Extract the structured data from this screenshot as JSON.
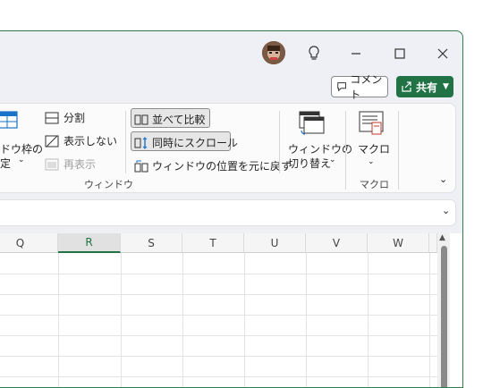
{
  "titlebar": {
    "minimize_icon": "minimize-icon",
    "maximize_icon": "maximize-icon",
    "close_icon": "close-icon",
    "lightbulb_icon": "lightbulb-icon"
  },
  "header": {
    "comment_label": "コメント",
    "share_label": "共有"
  },
  "ribbon": {
    "freeze_label_1": "ドウ枠の",
    "freeze_label_2": "定",
    "split_label": "分割",
    "hide_label": "表示しない",
    "unhide_label": "再表示",
    "side_by_side_label": "並べて比較",
    "sync_scroll_label": "同時にスクロール",
    "reset_position_label": "ウィンドウの位置を元に戻す",
    "switch_window_label_1": "ウィンドウの",
    "switch_window_label_2": "切り替え",
    "macro_label": "マクロ",
    "group_window_label": "ウィンドウ",
    "group_macro_label": "マクロ"
  },
  "columns": [
    "Q",
    "R",
    "S",
    "T",
    "U",
    "V",
    "W"
  ],
  "selected_column": "R",
  "colors": {
    "accent": "#217346",
    "border": "#2e7d4a"
  }
}
